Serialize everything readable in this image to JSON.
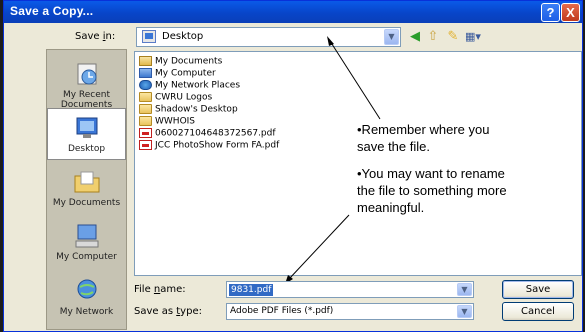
{
  "window": {
    "title": "Save a Copy...",
    "help_button": "?",
    "close_button": "X"
  },
  "save_in": {
    "label": "Save in:",
    "value": "Desktop"
  },
  "places": [
    {
      "label": "My Recent Documents",
      "icon": "recent-documents-icon"
    },
    {
      "label": "Desktop",
      "icon": "desktop-icon",
      "active": true
    },
    {
      "label": "My Documents",
      "icon": "my-documents-icon"
    },
    {
      "label": "My Computer",
      "icon": "my-computer-icon"
    },
    {
      "label": "My Network",
      "icon": "my-network-icon"
    }
  ],
  "files": [
    {
      "name": "My Documents",
      "icon": "my-documents-folder-icon"
    },
    {
      "name": "My Computer",
      "icon": "computer-icon"
    },
    {
      "name": "My Network Places",
      "icon": "network-places-icon"
    },
    {
      "name": "CWRU Logos",
      "icon": "folder-icon"
    },
    {
      "name": "Shadow's Desktop",
      "icon": "folder-icon"
    },
    {
      "name": "WWHOIS",
      "icon": "folder-icon"
    },
    {
      "name": "060027104648372567.pdf",
      "icon": "pdf-icon"
    },
    {
      "name": "JCC PhotoShow Form FA.pdf",
      "icon": "pdf-icon"
    }
  ],
  "annotation": {
    "line1": "•Remember where you",
    "line2": "save the file.",
    "line3": "•You may want to rename",
    "line4": "the file to something more",
    "line5": "meaningful."
  },
  "file_name": {
    "label": "File name:",
    "value": "9831.pdf"
  },
  "save_as_type": {
    "label": "Save as type:",
    "value": "Adobe PDF Files (*.pdf)"
  },
  "buttons": {
    "save": "Save",
    "cancel": "Cancel"
  },
  "colors": {
    "title_bar": "#0845c9",
    "dialog_bg": "#ece9d8",
    "selection": "#316ac5"
  }
}
